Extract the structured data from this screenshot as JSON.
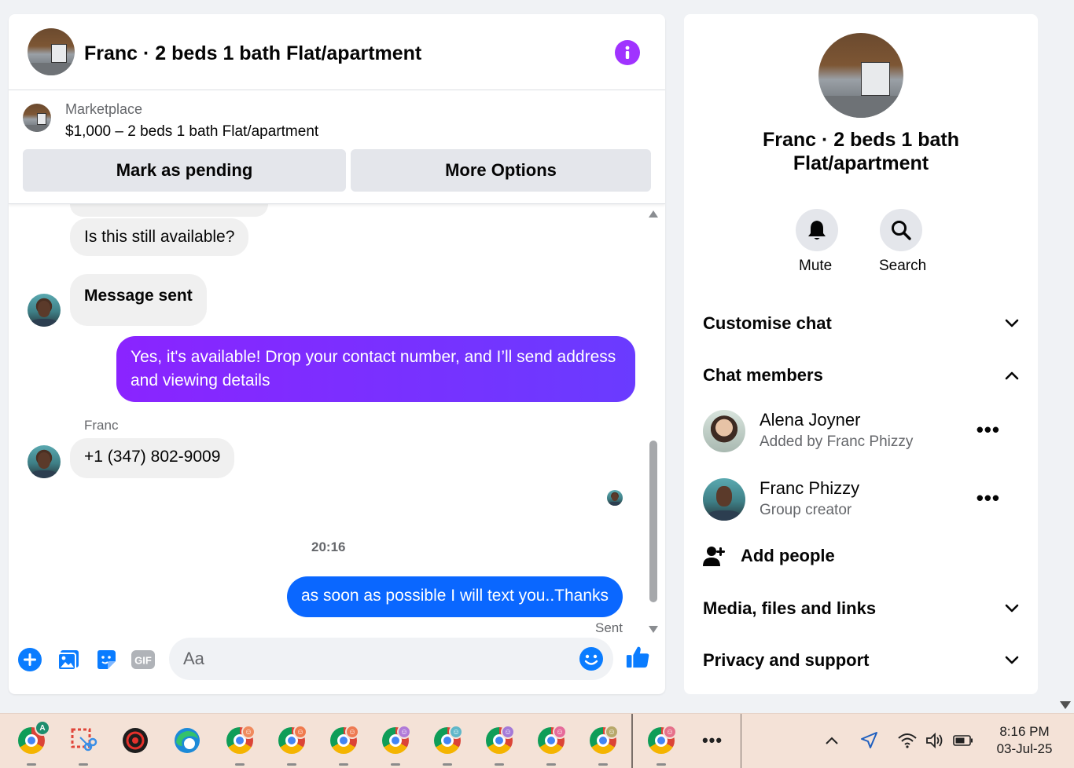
{
  "chat": {
    "title": "Franc · 2 beds 1 bath Flat/apartment",
    "listing": {
      "kicker": "Marketplace",
      "price_line": "$1,000 – 2 beds 1 bath Flat/apartment",
      "pending_button": "Mark as pending",
      "more_button": "More Options"
    },
    "messages": [
      {
        "text": "Is this still available?",
        "direction": "incoming"
      },
      {
        "text": "Message sent",
        "direction": "incoming"
      },
      {
        "text": "Yes, it's available! Drop your contact number, and I’ll send address and viewing details",
        "direction": "outgoing"
      },
      {
        "sender": "Franc",
        "text": "+1 (347) 802-9009",
        "direction": "incoming"
      },
      {
        "timestamp": "20:16"
      },
      {
        "text": "as soon as possible I will text you..Thanks",
        "direction": "outgoing",
        "status": "Sent"
      }
    ],
    "composer": {
      "placeholder": "Aa"
    },
    "colors": {
      "accent_purple": "#a033ff",
      "bubble_blue": "#0a67ff",
      "icon_blue": "#0a7cff"
    }
  },
  "info_panel": {
    "title": "Franc · 2 beds 1 bath Flat/apartment",
    "mute_label": "Mute",
    "search_label": "Search",
    "sections": {
      "customise": "Customise chat",
      "members": "Chat members",
      "media": "Media, files and links",
      "privacy": "Privacy and support"
    },
    "members": [
      {
        "name": "Alena Joyner",
        "subtitle": "Added by Franc Phizzy"
      },
      {
        "name": "Franc Phizzy",
        "subtitle": "Group creator"
      }
    ],
    "add_people": "Add people"
  },
  "taskbar": {
    "time": "8:16 PM",
    "date": "03-Jul-25",
    "chrome_badge_letter": "A"
  }
}
